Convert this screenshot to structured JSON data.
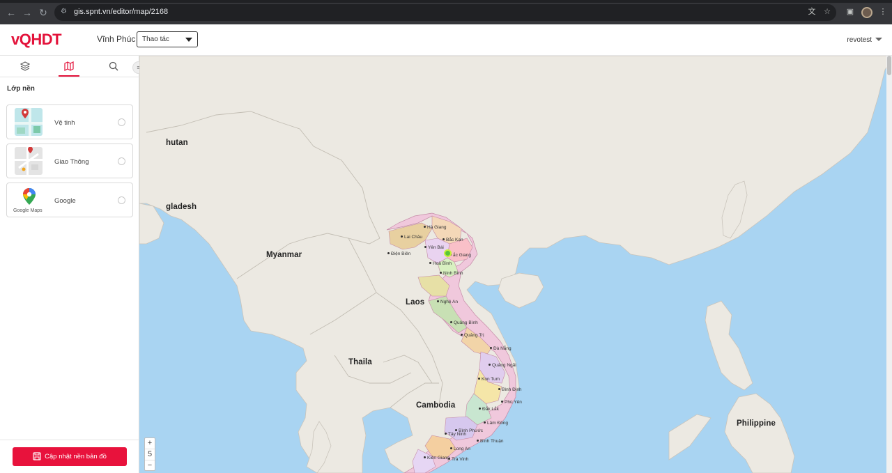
{
  "browser": {
    "url": "gis.spnt.vn/editor/map/2168"
  },
  "header": {
    "logo": "vQHDT",
    "region": "Vĩnh Phúc",
    "action_select": "Thao tác",
    "user": "revotest"
  },
  "sidebar": {
    "tabs": [
      {
        "icon": "layers-icon"
      },
      {
        "icon": "map-icon",
        "active": true
      },
      {
        "icon": "search-icon"
      }
    ],
    "section_title": "Lớp nền",
    "layers": [
      {
        "label": "Vệ tinh",
        "icon": "satellite-map-icon",
        "selected": false
      },
      {
        "label": "Giao Thông",
        "icon": "traffic-map-icon",
        "selected": false
      },
      {
        "label": "Google",
        "icon": "google-maps-icon",
        "caption": "Google Maps",
        "selected": false
      }
    ],
    "update_button": "Cập nhật nền bản đồ"
  },
  "map": {
    "countries": [
      "hutan",
      "gladesh",
      "Myanmar",
      "Laos",
      "Thaila",
      "Cambodia",
      "Philippine"
    ],
    "provinces": [
      "Hà Giang",
      "Lai Châu",
      "Bắc Kạn",
      "Yên Bái",
      "Điện Biên",
      "ắc Giang",
      "Hoà Bình",
      "Ninh Bình",
      "Nghệ An",
      "Quảng Bình",
      "Quảng Trị",
      "Đà Nẵng",
      "Quảng Ngãi",
      "Kon Tum",
      "Bình Định",
      "Phú Yên",
      "Đắk Lắk",
      "Lâm Đồng",
      "Bình Phước",
      "Tây Ninh",
      "Long An",
      "Bình Thuận",
      "Kiên Giang",
      "Trà Vinh"
    ],
    "zoom_in": "+",
    "zoom_level": "5",
    "zoom_out": "−"
  },
  "colors": {
    "brand": "#e3123a",
    "sea": "#a9d4f2",
    "land": "#ece9e2"
  }
}
